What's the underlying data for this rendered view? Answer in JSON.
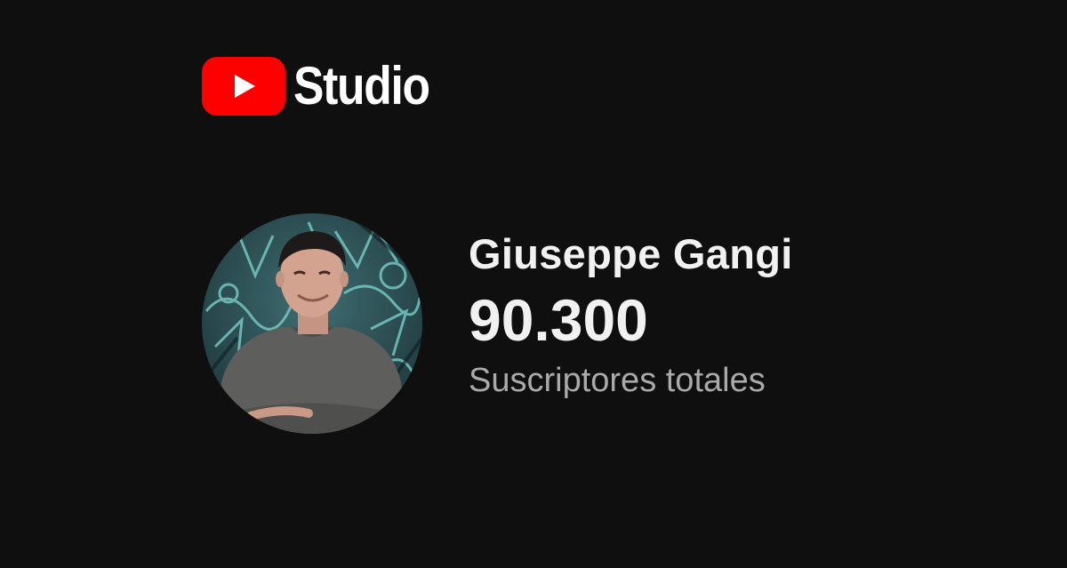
{
  "brand": {
    "logo_icon": "youtube-play-icon",
    "logo_text": "Studio",
    "accent_color": "#ff0000"
  },
  "channel": {
    "avatar": "channel-avatar-photo",
    "name": "Giuseppe Gangi",
    "subscriber_count": "90.300",
    "subscriber_label": "Suscriptores totales"
  },
  "theme": {
    "background": "#0f0f0f",
    "text_primary": "#f1f1f1",
    "text_secondary": "#aaaaaa"
  }
}
